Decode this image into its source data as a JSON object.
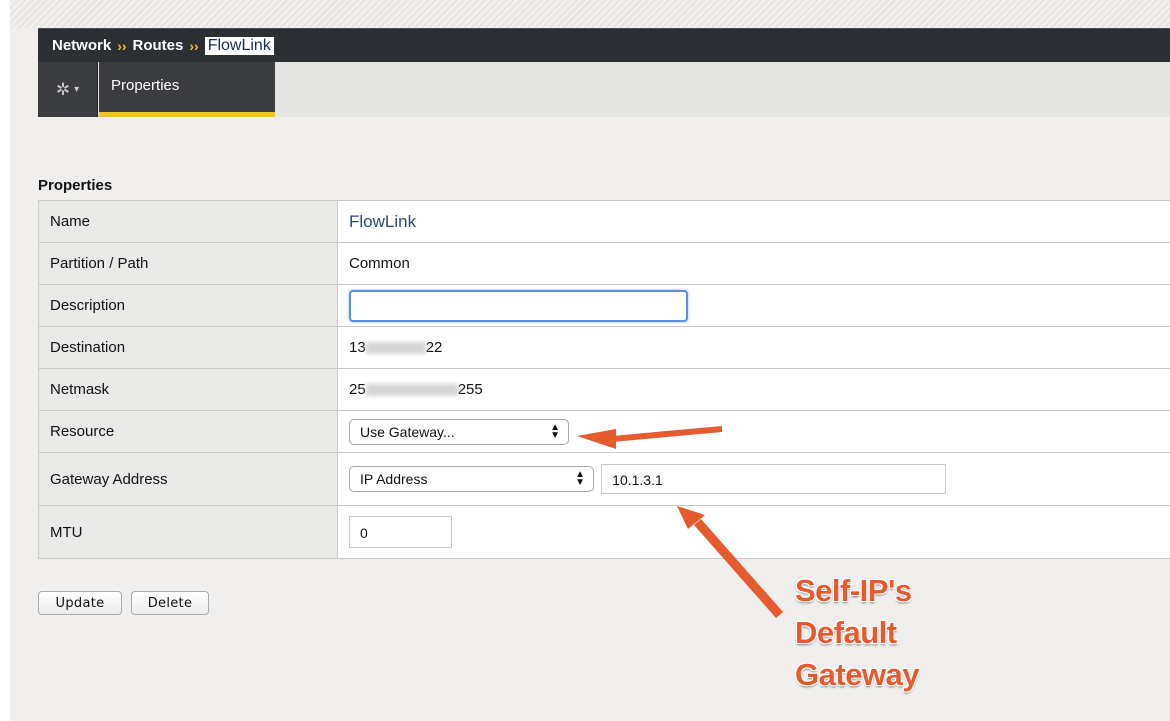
{
  "breadcrumb": {
    "items": [
      "Network",
      "Routes"
    ],
    "current": "FlowLink",
    "separator": "››"
  },
  "tabs": {
    "gear": "✲",
    "gear_caret": "▾",
    "active": "Properties"
  },
  "section_title": "Properties",
  "fields": {
    "name": {
      "label": "Name",
      "value": "FlowLink"
    },
    "partition": {
      "label": "Partition / Path",
      "value": "Common"
    },
    "description": {
      "label": "Description",
      "value": ""
    },
    "destination": {
      "label": "Destination",
      "value_start": "13",
      "value_end": "22"
    },
    "netmask": {
      "label": "Netmask",
      "value_start": "25",
      "value_end": "255"
    },
    "resource": {
      "label": "Resource",
      "selected": "Use Gateway..."
    },
    "gateway": {
      "label": "Gateway Address",
      "type_selected": "IP Address",
      "address": "10.1.3.1"
    },
    "mtu": {
      "label": "MTU",
      "value": "0"
    }
  },
  "buttons": {
    "update": "Update",
    "delete": "Delete"
  },
  "annotation": {
    "lines": [
      "Self-IP's",
      "Default",
      "Gateway"
    ]
  },
  "colors": {
    "accent": "#f3c32b",
    "annotation": "#e55a2e",
    "header_bg": "#2c2f33"
  }
}
